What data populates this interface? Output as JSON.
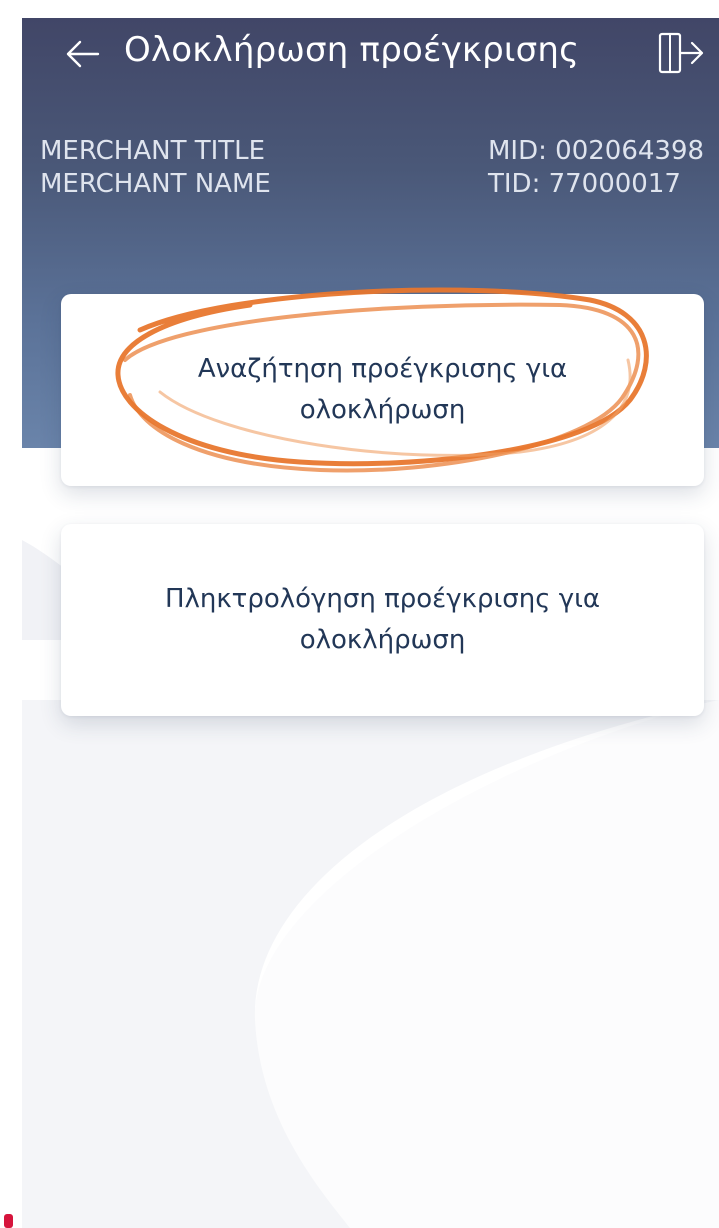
{
  "header": {
    "title": "Ολοκλήρωση προέγκρισης",
    "back_icon": "arrow-left-icon",
    "logout_icon": "logout-icon"
  },
  "merchant": {
    "title": "MERCHANT TITLE",
    "name": "MERCHANT NAME",
    "mid": "MID: 002064398",
    "tid": "TID: 77000017"
  },
  "options": [
    {
      "label": "Αναζήτηση προέγκρισης για ολοκλήρωση"
    },
    {
      "label": "Πληκτρολόγηση προέγκρισης για ολοκλήρωση"
    }
  ],
  "colors": {
    "header_top": "#414667",
    "header_bottom": "#6a84aa",
    "card_text": "#223757",
    "annotation": "#e8772e"
  }
}
